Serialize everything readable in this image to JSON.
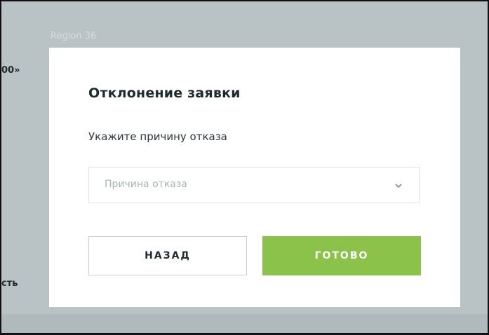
{
  "background": {
    "region_label": "Region 36",
    "left_text_top": "00»",
    "left_text_bottom": "сть"
  },
  "modal": {
    "title": "Отклонение заявки",
    "subtitle": "Укажите причину отказа",
    "reason_select": {
      "placeholder": "Причина отказа",
      "icon": "chevron-down-icon"
    },
    "back_label": "НАЗАД",
    "done_label": "ГОТОВО"
  },
  "colors": {
    "overlay": "#b9c2c4",
    "accent": "#8bc34a",
    "text_dark": "#1d2b2f"
  }
}
